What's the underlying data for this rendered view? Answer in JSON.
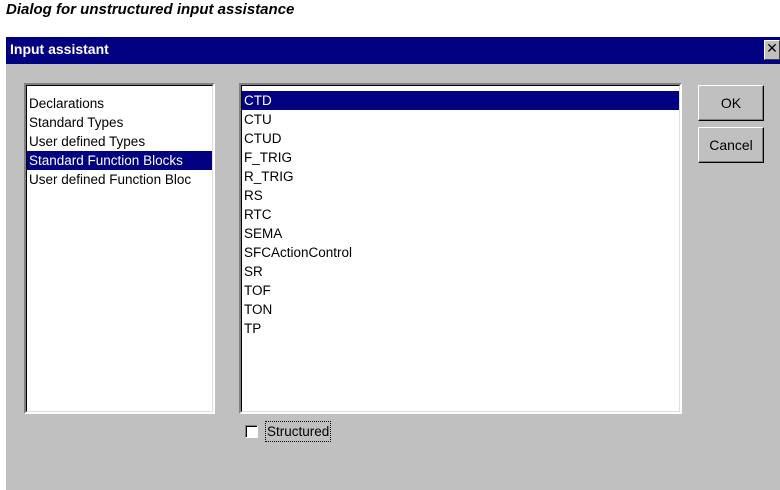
{
  "caption": "Dialog for unstructured input assistance",
  "window": {
    "title": "Input assistant",
    "close_glyph": "✕"
  },
  "categories": {
    "items": [
      {
        "label": "Declarations",
        "selected": false
      },
      {
        "label": "Standard Types",
        "selected": false
      },
      {
        "label": "User defined Types",
        "selected": false
      },
      {
        "label": "Standard Function Blocks",
        "selected": true
      },
      {
        "label": "User defined Function Bloc",
        "selected": false
      }
    ]
  },
  "items": {
    "entries": [
      {
        "label": "CTD",
        "selected": true
      },
      {
        "label": "CTU",
        "selected": false
      },
      {
        "label": "CTUD",
        "selected": false
      },
      {
        "label": "F_TRIG",
        "selected": false
      },
      {
        "label": "R_TRIG",
        "selected": false
      },
      {
        "label": "RS",
        "selected": false
      },
      {
        "label": "RTC",
        "selected": false
      },
      {
        "label": "SEMA",
        "selected": false
      },
      {
        "label": "SFCActionControl",
        "selected": false
      },
      {
        "label": "SR",
        "selected": false
      },
      {
        "label": "TOF",
        "selected": false
      },
      {
        "label": "TON",
        "selected": false
      },
      {
        "label": "TP",
        "selected": false
      }
    ]
  },
  "buttons": {
    "ok_label": "OK",
    "cancel_label": "Cancel"
  },
  "structured": {
    "label": "Structured",
    "checked": false
  },
  "colors": {
    "titlebar": "#000080",
    "dialog_bg": "#c0c0c0",
    "selection": "#000080"
  }
}
